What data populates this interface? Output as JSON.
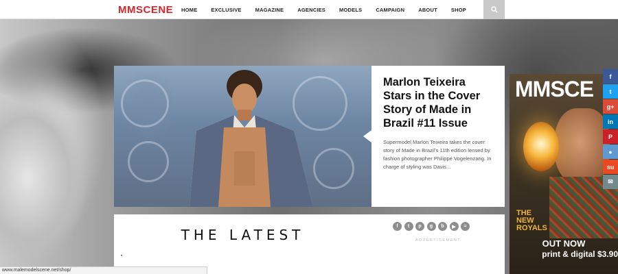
{
  "site": {
    "logo": "MMSCENE"
  },
  "nav": {
    "items": [
      "HOME",
      "EXCLUSIVE",
      "MAGAZINE",
      "AGENCIES",
      "MODELS",
      "CAMPAIGN",
      "ABOUT",
      "SHOP"
    ]
  },
  "featured": {
    "title": "Marlon Teixeira Stars in the Cover Story of Made in Brazil #11 Issue",
    "excerpt": "Supermodel Marlon Teixeira takes the cover story of Made in Brazil's 11th edition lensed by fashion photographer Philippe Vogelenzang. In charge of styling was Davis..."
  },
  "latest": {
    "heading": "THE LATEST"
  },
  "sidebar": {
    "advertisement_label": "ADVERTISEMENT",
    "social_icons": [
      "facebook-icon",
      "twitter-icon",
      "pinterest-icon",
      "google-plus-icon",
      "bloglovin-icon",
      "youtube-icon",
      "rss-icon"
    ]
  },
  "ad": {
    "masthead": "MMSCE",
    "cover_line": "THE NEW ROYALS",
    "out_now": "OUT NOW",
    "print_digital": "print & digital $3.90"
  },
  "share_rail": {
    "buttons": [
      {
        "icon": "facebook-icon",
        "color": "#3b5998"
      },
      {
        "icon": "twitter-icon",
        "color": "#1da1f2"
      },
      {
        "icon": "google-plus-icon",
        "color": "#dd4b39"
      },
      {
        "icon": "linkedin-icon",
        "color": "#0077b5"
      },
      {
        "icon": "pinterest-icon",
        "color": "#cb2027"
      },
      {
        "icon": "reddit-icon",
        "color": "#5f99cf"
      },
      {
        "icon": "stumbleupon-icon",
        "color": "#eb4924"
      },
      {
        "icon": "email-icon",
        "color": "#738a8d"
      }
    ]
  },
  "status_bar": {
    "url": "www.malemodelscene.net/shop/"
  },
  "colors": {
    "brand_red": "#d7262b",
    "social_gray": "#8e8e8e"
  }
}
